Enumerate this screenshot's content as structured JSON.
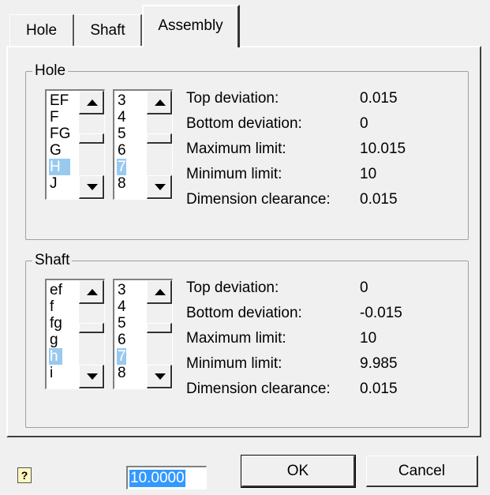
{
  "tabs": [
    {
      "label": "Hole",
      "active": false
    },
    {
      "label": "Shaft",
      "active": false
    },
    {
      "label": "Assembly",
      "active": true
    }
  ],
  "hole": {
    "title": "Hole",
    "letters": [
      "EF",
      "F",
      "FG",
      "G",
      "H",
      "J"
    ],
    "letters_selected": "H",
    "grades": [
      "3",
      "4",
      "5",
      "6",
      "7",
      "8"
    ],
    "grades_selected": "7",
    "info": [
      {
        "label": "Top deviation:",
        "value": "0.015"
      },
      {
        "label": "Bottom deviation:",
        "value": "0"
      },
      {
        "label": "Maximum limit:",
        "value": "10.015"
      },
      {
        "label": "Minimum limit:",
        "value": "10"
      },
      {
        "label": "Dimension clearance:",
        "value": "0.015"
      }
    ]
  },
  "shaft": {
    "title": "Shaft",
    "letters": [
      "ef",
      "f",
      "fg",
      "g",
      "h",
      "i"
    ],
    "letters_selected": "h",
    "grades": [
      "3",
      "4",
      "5",
      "6",
      "7",
      "8"
    ],
    "grades_selected": "7",
    "info": [
      {
        "label": "Top deviation:",
        "value": "0"
      },
      {
        "label": "Bottom deviation:",
        "value": "-0.015"
      },
      {
        "label": "Maximum limit:",
        "value": "10"
      },
      {
        "label": "Minimum limit:",
        "value": "9.985"
      },
      {
        "label": "Dimension clearance:",
        "value": "0.015"
      }
    ]
  },
  "footer": {
    "help_icon": "help-icon",
    "nominal_value": "10.0000",
    "ok_label": "OK",
    "cancel_label": "Cancel"
  }
}
